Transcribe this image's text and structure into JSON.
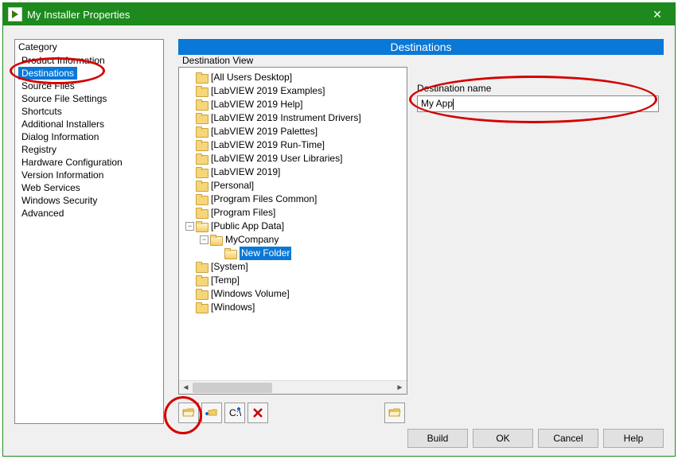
{
  "window": {
    "title": "My Installer Properties"
  },
  "category": {
    "header": "Category",
    "items": [
      "Product Information",
      "Destinations",
      "Source Files",
      "Source File Settings",
      "Shortcuts",
      "Additional Installers",
      "Dialog Information",
      "Registry",
      "Hardware Configuration",
      "Version Information",
      "Web Services",
      "Windows Security",
      "Advanced"
    ],
    "selected_index": 1
  },
  "destinations": {
    "section_title": "Destinations",
    "view_label": "Destination View",
    "tree": [
      {
        "depth": 0,
        "exp": "empty",
        "label": "[All Users Desktop]"
      },
      {
        "depth": 0,
        "exp": "empty",
        "label": "[LabVIEW 2019 Examples]"
      },
      {
        "depth": 0,
        "exp": "empty",
        "label": "[LabVIEW 2019 Help]"
      },
      {
        "depth": 0,
        "exp": "empty",
        "label": "[LabVIEW 2019 Instrument Drivers]"
      },
      {
        "depth": 0,
        "exp": "empty",
        "label": "[LabVIEW 2019 Palettes]"
      },
      {
        "depth": 0,
        "exp": "empty",
        "label": "[LabVIEW 2019 Run-Time]"
      },
      {
        "depth": 0,
        "exp": "empty",
        "label": "[LabVIEW 2019 User Libraries]"
      },
      {
        "depth": 0,
        "exp": "empty",
        "label": "[LabVIEW 2019]"
      },
      {
        "depth": 0,
        "exp": "empty",
        "label": "[Personal]"
      },
      {
        "depth": 0,
        "exp": "empty",
        "label": "[Program Files Common]"
      },
      {
        "depth": 0,
        "exp": "empty",
        "label": "[Program Files]"
      },
      {
        "depth": 0,
        "exp": "minus",
        "label": "[Public App Data]",
        "open": true
      },
      {
        "depth": 1,
        "exp": "minus",
        "label": "MyCompany",
        "open": true
      },
      {
        "depth": 2,
        "exp": "none",
        "label": "New Folder",
        "open": true,
        "selected": true
      },
      {
        "depth": 0,
        "exp": "empty",
        "label": "[System]"
      },
      {
        "depth": 0,
        "exp": "empty",
        "label": "[Temp]"
      },
      {
        "depth": 0,
        "exp": "empty",
        "label": "[Windows Volume]"
      },
      {
        "depth": 0,
        "exp": "empty",
        "label": "[Windows]"
      }
    ],
    "name_label": "Destination name",
    "name_value": "My App"
  },
  "toolbar_icons": [
    "open-folder-icon",
    "add-subfolder-icon",
    "add-key-icon",
    "delete-icon",
    "browse-destination-icon"
  ],
  "footer": {
    "build": "Build",
    "ok": "OK",
    "cancel": "Cancel",
    "help": "Help"
  }
}
